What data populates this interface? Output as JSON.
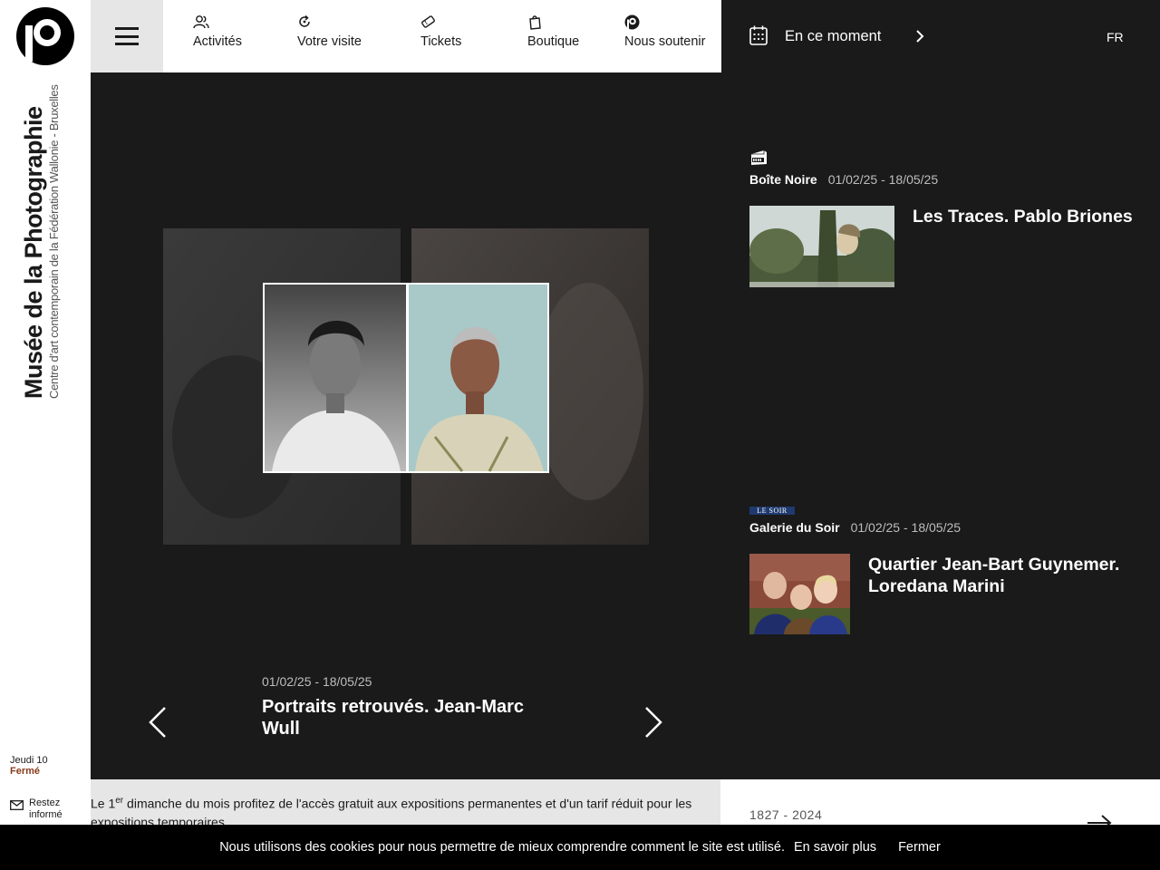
{
  "sidebar": {
    "museum_name": "Musée de la Photographie",
    "subtitle": "Centre d'art contemporain de la Fédération Wallonie - Bruxelles",
    "day": "Jeudi 10",
    "status": "Fermé",
    "newsletter_label": "Restez informé"
  },
  "nav": {
    "items": [
      {
        "label": "Activités",
        "icon": "people-icon"
      },
      {
        "label": "Votre visite",
        "icon": "refresh-icon"
      },
      {
        "label": "Tickets",
        "icon": "ticket-icon"
      },
      {
        "label": "Boutique",
        "icon": "bag-icon"
      },
      {
        "label": "Nous soutenir",
        "icon": "museum-logo-icon"
      }
    ]
  },
  "now": {
    "label": "En ce moment",
    "lang": "FR"
  },
  "hero": {
    "dates": "01/02/25  - 18/05/25",
    "title": "Portraits retrouvés. Jean-Marc Wull"
  },
  "exhibitions": [
    {
      "logo": "boite-noire-icon",
      "venue": "Boîte Noire",
      "dates": "01/02/25  - 18/05/25",
      "title": "Les Traces. Pablo Briones"
    },
    {
      "logo": "LE SOIR",
      "venue": "Galerie du Soir",
      "dates": "01/02/25  - 18/05/25",
      "title": "Quartier Jean-Bart Guynemer. Loredana Marini"
    }
  ],
  "info": {
    "prefix": "Le 1",
    "sup": "er",
    "text": " dimanche du mois profitez de l'accès gratuit aux expositions permanentes et d'un tarif réduit pour les expositions temporaires."
  },
  "history": {
    "years": "1827 - 2024"
  },
  "cookie": {
    "message": "Nous utilisons des cookies pour nous permettre de mieux comprendre comment le site est utilisé.",
    "more": "En savoir plus",
    "close": "Fermer"
  },
  "colors": {
    "dark_bg": "#1a1a1b",
    "grey_panel": "#e6e6e6",
    "status_closed": "#8a3a1a"
  }
}
